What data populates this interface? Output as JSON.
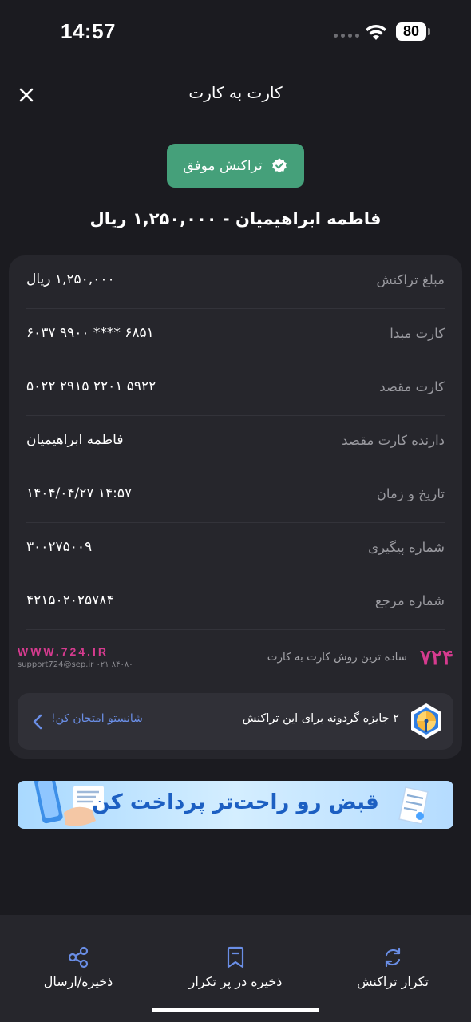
{
  "status_bar": {
    "time": "14:57",
    "battery": "80"
  },
  "header": {
    "title": "کارت به کارت"
  },
  "status_badge": {
    "label": "تراکنش موفق",
    "color": "#45a07a"
  },
  "summary": "فاطمه ابراهیمیان - ۱,۲۵۰,۰۰۰ ریال",
  "details": [
    {
      "label": "مبلغ تراکنش",
      "value": "۱,۲۵۰,۰۰۰ ریال"
    },
    {
      "label": "کارت مبدا",
      "value": "۶۰۳۷ ۹۹۰۰ **** ۶۸۵۱"
    },
    {
      "label": "کارت مقصد",
      "value": "۵۰۲۲ ۲۹۱۵ ۲۲۰۱ ۵۹۲۲"
    },
    {
      "label": "دارنده کارت مقصد",
      "value": "فاطمه ابراهیمیان"
    },
    {
      "label": "تاریخ و زمان",
      "value": "۱۴۰۴/۰۴/۲۷ ۱۴:۵۷"
    },
    {
      "label": "شماره پیگیری",
      "value": "۳۰۰۲۷۵۰۰۹"
    },
    {
      "label": "شماره مرجع",
      "value": "۴۲۱۵۰۲۰۲۵۷۸۴"
    }
  ],
  "brand": {
    "url": "WWW.724.IR",
    "support": "support724@sep.ir  ۰۲۱ ۸۴۰۸۰",
    "logo": "۷۲۴",
    "slogan": "ساده ترین روش کارت به کارت",
    "color": "#d63b8f"
  },
  "prize": {
    "text": "۲ جایزه گردونه برای این تراکنش",
    "cta": "شانستو امتحان کن!"
  },
  "banner": {
    "text": "قبض رو راحت‌تر پرداخت کن"
  },
  "bottom_actions": {
    "share": "ذخیره/ارسال",
    "save_repeat": "ذخیره در پر تکرار",
    "repeat": "تکرار تراکنش"
  }
}
